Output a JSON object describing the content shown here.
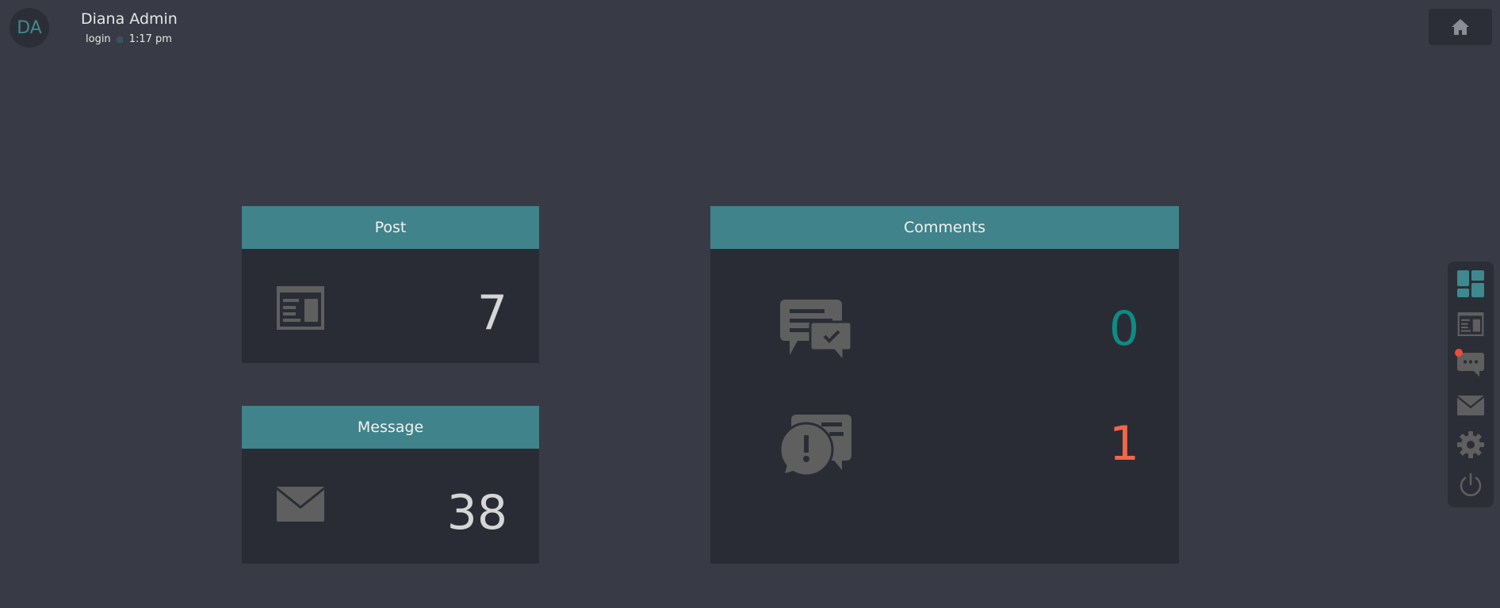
{
  "user": {
    "initials": "DA",
    "name": "Diana Admin",
    "login_label": "login",
    "login_time": "1:17 pm"
  },
  "cards": {
    "post": {
      "title": "Post",
      "count": "7",
      "icon": "newspaper-icon"
    },
    "message": {
      "title": "Message",
      "count": "38",
      "icon": "envelope-icon"
    },
    "comments": {
      "title": "Comments",
      "approved_count": "0",
      "approved_icon": "comments-check-icon",
      "pending_count": "1",
      "pending_icon": "comments-alert-icon"
    }
  },
  "sidebar": {
    "items": [
      {
        "name": "dashboard",
        "icon": "dashboard-icon",
        "active": true
      },
      {
        "name": "posts",
        "icon": "newspaper-icon"
      },
      {
        "name": "comments",
        "icon": "comment-dots-icon",
        "notification": true
      },
      {
        "name": "messages",
        "icon": "envelope-icon"
      },
      {
        "name": "settings",
        "icon": "gear-icon"
      },
      {
        "name": "logout",
        "icon": "power-icon"
      }
    ]
  },
  "colors": {
    "background": "#383b45",
    "panel": "#292c35",
    "accent": "#40838a",
    "approved": "#0f8a84",
    "pending": "#f26649",
    "icon": "#5f5f5f",
    "notification": "#ef4b3a"
  }
}
